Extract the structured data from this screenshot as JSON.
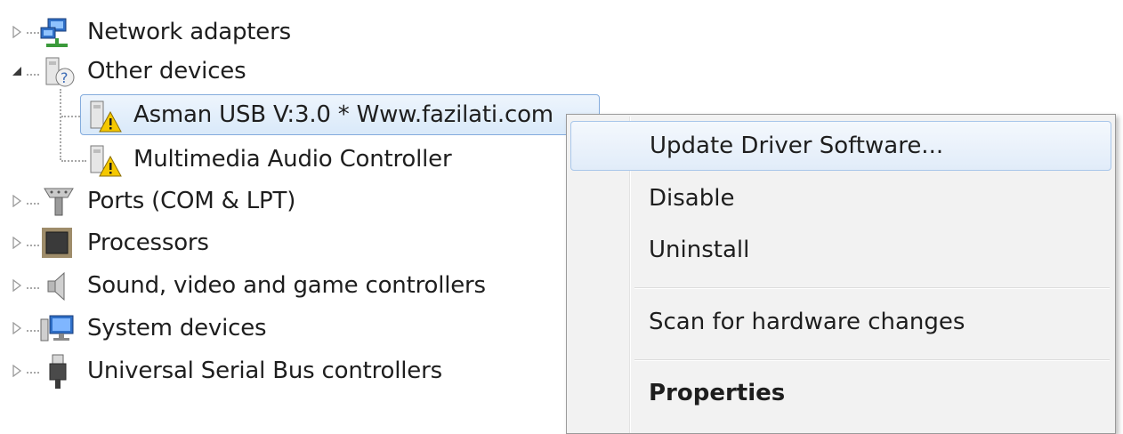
{
  "tree": {
    "items": [
      {
        "label": "Network adapters",
        "icon": "network-adapter-icon",
        "expander": "collapsed"
      },
      {
        "label": "Other devices",
        "icon": "unknown-device-icon",
        "expander": "expanded"
      },
      {
        "label": "Asman USB V:3.0 * Www.fazilati.com",
        "icon": "warning-device-icon",
        "selected": true
      },
      {
        "label": "Multimedia Audio Controller",
        "icon": "warning-device-icon"
      },
      {
        "label": "Ports (COM & LPT)",
        "icon": "port-icon",
        "expander": "collapsed"
      },
      {
        "label": "Processors",
        "icon": "processor-icon",
        "expander": "collapsed"
      },
      {
        "label": "Sound, video and game controllers",
        "icon": "speaker-icon",
        "expander": "collapsed"
      },
      {
        "label": "System devices",
        "icon": "computer-icon",
        "expander": "collapsed"
      },
      {
        "label": "Universal Serial Bus controllers",
        "icon": "usb-icon",
        "expander": "collapsed"
      }
    ]
  },
  "context_menu": {
    "items": [
      {
        "label": "Update Driver Software...",
        "hovered": true
      },
      {
        "label": "Disable"
      },
      {
        "label": "Uninstall"
      },
      {
        "label": "Scan for hardware changes"
      },
      {
        "label": "Properties",
        "bold": true
      }
    ]
  },
  "colors": {
    "selection_border": "#84acdd",
    "menu_background": "#f2f2f2",
    "warning": "#f5c800"
  }
}
